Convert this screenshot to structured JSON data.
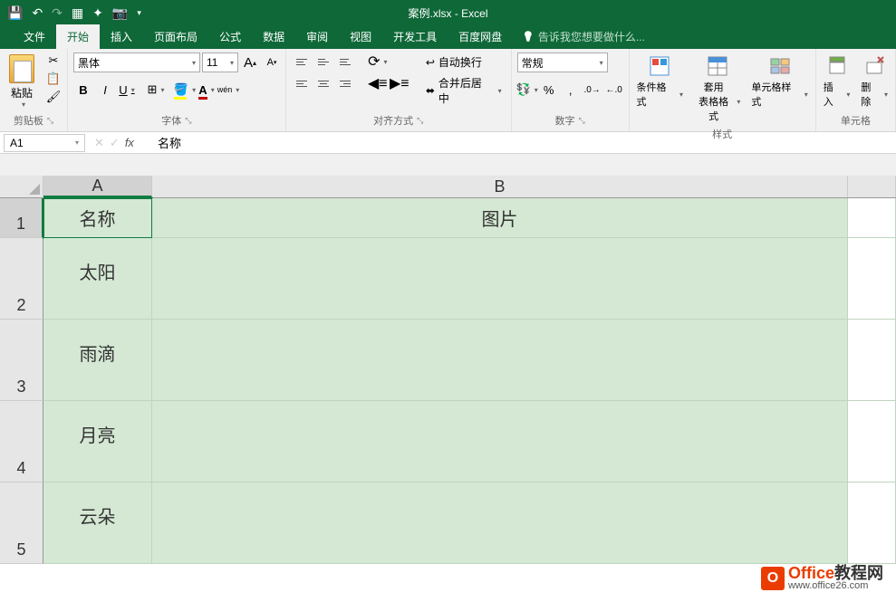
{
  "titlebar": {
    "filename": "案例.xlsx - Excel"
  },
  "tabs": {
    "file": "文件",
    "home": "开始",
    "insert": "插入",
    "page_layout": "页面布局",
    "formulas": "公式",
    "data": "数据",
    "review": "审阅",
    "view": "视图",
    "developer": "开发工具",
    "baidu": "百度网盘",
    "tell_me": "告诉我您想要做什么..."
  },
  "ribbon": {
    "clipboard": {
      "paste": "粘贴",
      "label": "剪贴板"
    },
    "font": {
      "name": "黑体",
      "size": "11",
      "label": "字体",
      "increase": "A",
      "decrease": "A",
      "wen": "wén",
      "bold": "B",
      "italic": "I",
      "underline": "U"
    },
    "alignment": {
      "wrap": "自动换行",
      "merge": "合并后居中",
      "label": "对齐方式"
    },
    "number": {
      "format": "常规",
      "label": "数字"
    },
    "styles": {
      "conditional": "条件格式",
      "table": "套用\n表格格式",
      "cell": "单元格样式",
      "label": "样式"
    },
    "cells": {
      "insert": "插入",
      "delete": "删除",
      "label": "单元格"
    }
  },
  "formula_bar": {
    "name_box": "A1",
    "value": "名称"
  },
  "grid": {
    "columns": [
      "A",
      "B"
    ],
    "rows": [
      "1",
      "2",
      "3",
      "4",
      "5"
    ],
    "data": {
      "A1": "名称",
      "B1": "图片",
      "A2": "太阳",
      "A3": "雨滴",
      "A4": "月亮",
      "A5": "云朵"
    },
    "selected_cell": "A1"
  },
  "watermark": {
    "main_orange": "Office",
    "main_black": "教程网",
    "url": "www.office26.com"
  }
}
